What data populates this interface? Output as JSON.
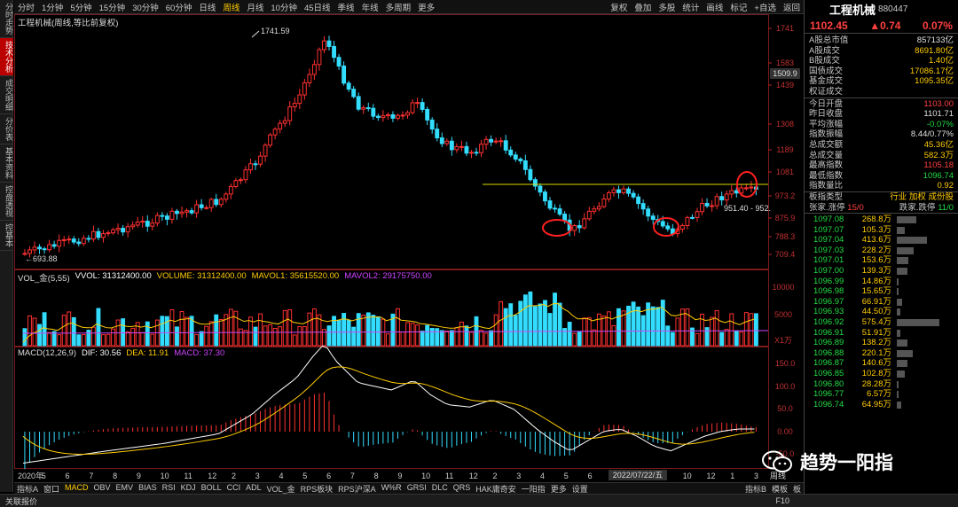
{
  "left_tabs": [
    "分时走势",
    "技术分析",
    "成交明细",
    "分价表",
    "基本资料",
    "控盘透视",
    "控基本"
  ],
  "left_active": 1,
  "toolbar": {
    "periods": [
      "分时",
      "1分钟",
      "5分钟",
      "15分钟",
      "30分钟",
      "60分钟",
      "日线",
      "周线",
      "月线",
      "10分钟",
      "45日线",
      "季线",
      "年线",
      "多周期",
      "更多"
    ],
    "active_period": "周线",
    "right_items": [
      "复权",
      "叠加",
      "多股",
      "统计",
      "画线",
      "标记",
      "+自选",
      "返回"
    ]
  },
  "chart": {
    "title": "工程机械(周线,等比前复权)",
    "price_axis": [
      "1741",
      "1583",
      "1439",
      "1308",
      "1189",
      "1081",
      "973.2",
      "875.9",
      "788.3",
      "709.4"
    ],
    "current_price_label": "1509.9",
    "high_label": "1741.59",
    "low_label": "←693.88",
    "range_label": "951.40 - 952.",
    "vol_title": "VOL_金(5,55)",
    "vol_readouts": [
      {
        "text": "VVOL: 31312400.00",
        "color": "#ffffff"
      },
      {
        "text": "VOLUME: 31312400.00",
        "color": "#ffcc00"
      },
      {
        "text": "MAVOL1: 35615520.00",
        "color": "#ffcc00"
      },
      {
        "text": "MAVOL2: 29175750.00",
        "color": "#cc44ff"
      }
    ],
    "vol_axis": [
      "10000",
      "5000"
    ],
    "vol_unit": "X1万",
    "macd_title": "MACD(12,26,9)",
    "macd_readouts": [
      {
        "text": "DIF: 30.56",
        "color": "#ffffff"
      },
      {
        "text": "DEA: 11.91",
        "color": "#ffcc00"
      },
      {
        "text": "MACD: 37.30",
        "color": "#cc44ff"
      }
    ],
    "macd_axis": [
      "150.0",
      "100.0",
      "50.0",
      "0.00",
      "-50.0"
    ],
    "time_axis": [
      "2020年",
      "5",
      "6",
      "7",
      "8",
      "9",
      "10",
      "11",
      "12",
      "2",
      "3",
      "4",
      "5",
      "6",
      "7",
      "8",
      "9",
      "10",
      "11",
      "12",
      "2",
      "3",
      "4",
      "5",
      "6",
      "7",
      "8",
      "9",
      "10",
      "12",
      "1",
      "3"
    ],
    "cursor_date": "2022/07/22/五",
    "corner": "周线"
  },
  "indicator_tabs": [
    "指标A",
    "窗口",
    "MACD",
    "OBV",
    "EMV",
    "BIAS",
    "RSI",
    "KDJ",
    "BOLL",
    "CCI",
    "ADL",
    "VOL_金",
    "RPS板块",
    "RPS沪深A",
    "W%R",
    "GRSI",
    "DLC",
    "QRS",
    "HAK庸奇安",
    "一阳指",
    "更多",
    "设置"
  ],
  "indicator_active": "MACD",
  "indicator_right": [
    "指标B",
    "模板",
    "板"
  ],
  "status": {
    "left": "关联报价",
    "right": "F10"
  },
  "right_panel": {
    "name": "工程机械",
    "code": "880447",
    "price": "1102.45",
    "change": "▲0.74",
    "pct": "0.07%",
    "stats1": [
      {
        "k": "A股总市值",
        "v": "857133亿",
        "c": "white"
      },
      {
        "k": " A股成交",
        "v": "8691.80亿",
        "c": "yellow"
      },
      {
        "k": " B股成交",
        "v": "1.40亿",
        "c": "yellow"
      },
      {
        "k": "国债成交",
        "v": "17086.17亿",
        "c": "yellow"
      },
      {
        "k": "基金成交",
        "v": "1095.35亿",
        "c": "yellow"
      },
      {
        "k": "权证成交",
        "v": "",
        "c": "yellow"
      }
    ],
    "stats2": [
      {
        "k": "今日开盘",
        "v": "1103.00",
        "c": "red"
      },
      {
        "k": "昨日收盘",
        "v": "1101.71",
        "c": "white"
      },
      {
        "k": "平均涨幅",
        "v": "-0.07%",
        "c": "green"
      },
      {
        "k": "指数振幅",
        "v": "8.44/0.77%",
        "c": "white"
      },
      {
        "k": "总成交额",
        "v": "45.36亿",
        "c": "yellow"
      },
      {
        "k": "总成交量",
        "v": "582.3万",
        "c": "yellow"
      },
      {
        "k": "最高指数",
        "v": "1105.18",
        "c": "red"
      },
      {
        "k": "最低指数",
        "v": "1096.74",
        "c": "green"
      },
      {
        "k": "指数量比",
        "v": "0.92",
        "c": "yellow"
      }
    ],
    "plate_type_label": "板指类型",
    "plate_type_value": "行业 加权 成份股",
    "updown": {
      "up_label": "张家.涨停",
      "up_val": "15/0",
      "down_label": "跌家.跌停",
      "down_val": "11/0"
    },
    "orderbook": [
      [
        "1097.08",
        "268.8万"
      ],
      [
        "1097.07",
        "105.3万"
      ],
      [
        "1097.04",
        "413.6万"
      ],
      [
        "1097.03",
        "228.2万"
      ],
      [
        "1097.01",
        "153.6万"
      ],
      [
        "1097.00",
        "139.3万"
      ],
      [
        "1096.99",
        "14.86万"
      ],
      [
        "1096.98",
        "15.65万"
      ],
      [
        "1096.97",
        "66.91万"
      ],
      [
        "1096.93",
        "44.50万"
      ],
      [
        "1096.92",
        "575.4万"
      ],
      [
        "1096.91",
        "51.91万"
      ],
      [
        "1096.89",
        "138.2万"
      ],
      [
        "1096.88",
        "220.1万"
      ],
      [
        "1096.87",
        "140.6万"
      ],
      [
        "1096.85",
        "102.8万"
      ],
      [
        "1096.80",
        "28.28万"
      ],
      [
        "1096.77",
        "6.57万"
      ],
      [
        "1096.74",
        "64.95万"
      ]
    ],
    "watermark": "趋势一阳指"
  }
}
